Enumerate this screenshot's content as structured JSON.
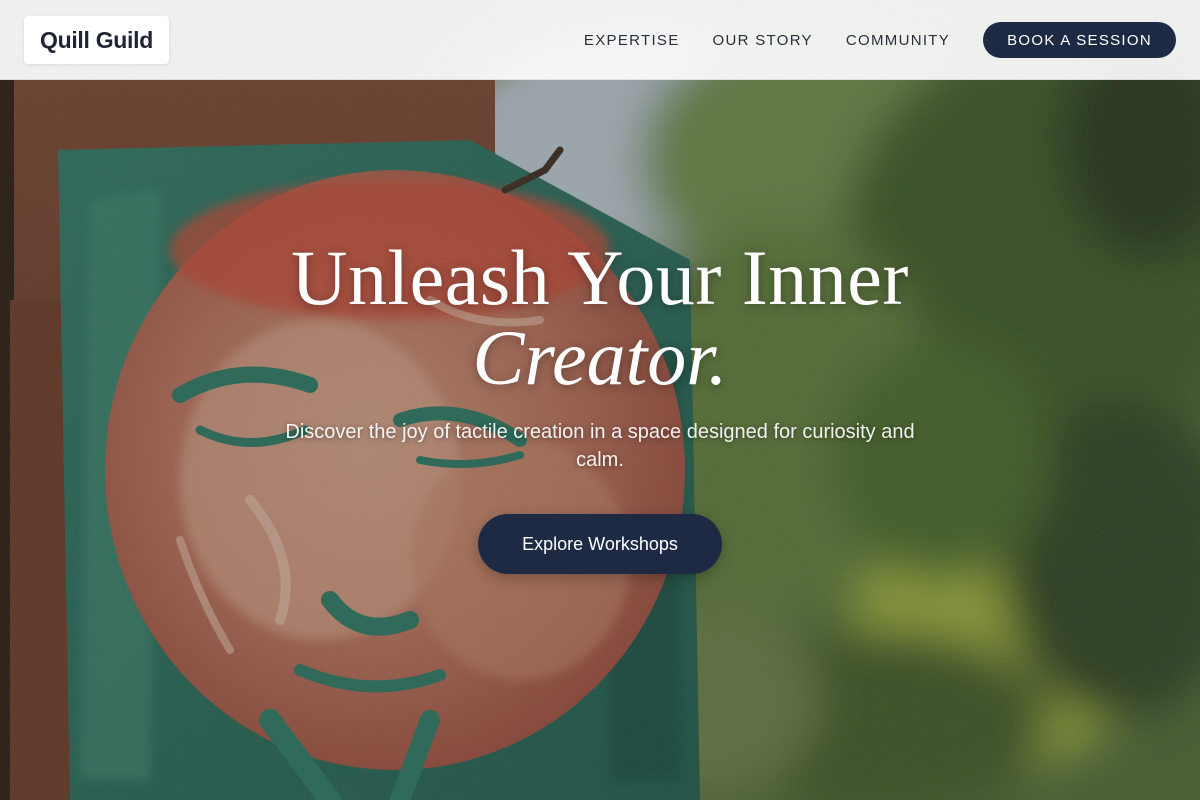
{
  "header": {
    "logo_text": "Quill Guild",
    "nav": [
      {
        "label": "EXPERTISE"
      },
      {
        "label": "OUR STORY"
      },
      {
        "label": "COMMUNITY"
      }
    ],
    "cta_label": "BOOK A SESSION"
  },
  "hero": {
    "title_line1": "Unleash Your Inner",
    "title_line2": "Creator.",
    "subtitle": "Discover the joy of tactile creation in a space designed for curiosity and calm.",
    "button_label": "Explore Workshops"
  },
  "colors": {
    "primary_navy": "#1e2a44",
    "header_bg": "#fafafa",
    "text_dark": "#1f2433",
    "hero_text": "#ffffff"
  }
}
